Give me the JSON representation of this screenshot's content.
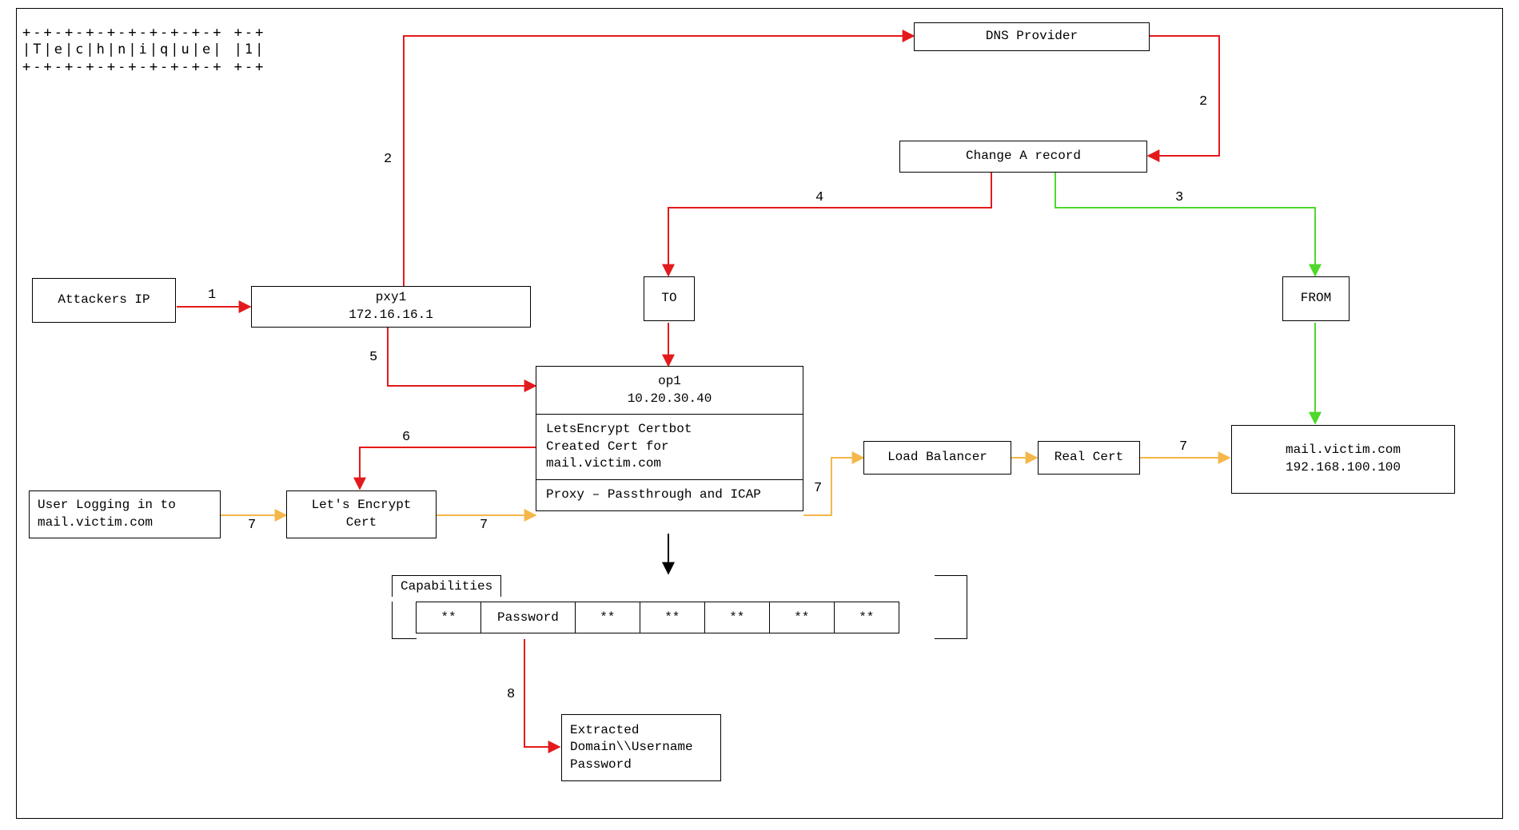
{
  "title_ascii": "+-+-+-+-+-+-+-+-+-+ +-+\n|T|e|c|h|n|i|q|u|e| |1|\n+-+-+-+-+-+-+-+-+-+ +-+",
  "nodes": {
    "dns_provider": "DNS Provider",
    "change_a_record": "Change A record",
    "attackers_ip": "Attackers IP",
    "pxy1_name": "pxy1",
    "pxy1_ip": "172.16.16.1",
    "to": "TO",
    "from": "FROM",
    "op1_name": "op1",
    "op1_ip": "10.20.30.40",
    "op1_row1": "LetsEncrypt Certbot\nCreated Cert for\nmail.victim.com",
    "op1_row2": "Proxy – Passthrough and ICAP",
    "lets_encrypt": "Let's Encrypt\nCert",
    "user_login": "User Logging in to\nmail.victim.com",
    "load_balancer": "Load Balancer",
    "real_cert": "Real Cert",
    "mail_victim_name": "mail.victim.com",
    "mail_victim_ip": "192.168.100.100",
    "caps_label": "Capabilities",
    "caps_cells": [
      "**",
      "Password",
      "**",
      "**",
      "**",
      "**",
      "**"
    ],
    "extracted": "Extracted\nDomain\\\\Username\nPassword"
  },
  "edge_labels": {
    "e1": "1",
    "e2a": "2",
    "e2b": "2",
    "e3": "3",
    "e4": "4",
    "e5": "5",
    "e6": "6",
    "e7a": "7",
    "e7b": "7",
    "e7c": "7",
    "e7d": "7",
    "e8": "8"
  },
  "colors": {
    "red": "#e31a1c",
    "green": "#4fd82c",
    "orange": "#f5b749",
    "black": "#000000"
  }
}
